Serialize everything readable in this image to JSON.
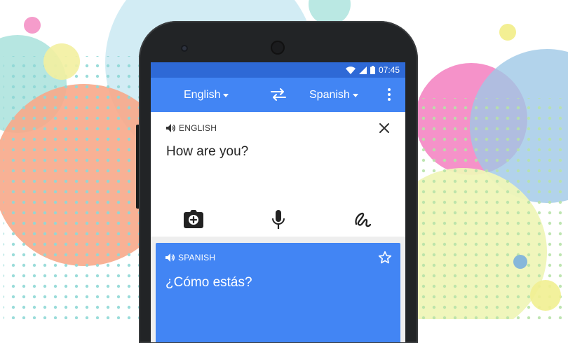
{
  "status_bar": {
    "time": "07:45"
  },
  "toolbar": {
    "source_language": "English",
    "target_language": "Spanish"
  },
  "input_card": {
    "language_label": "ENGLISH",
    "text": "How are you?"
  },
  "output_card": {
    "language_label": "SPANISH",
    "text": "¿Cómo estás?"
  },
  "colors": {
    "primary": "#4285f4",
    "status_bar": "#2e69d6",
    "phone_body": "#222426"
  },
  "icons": [
    "wifi-icon",
    "signal-icon",
    "battery-icon",
    "swap-icon",
    "more-vert-icon",
    "volume-icon",
    "close-icon",
    "camera-icon",
    "mic-icon",
    "handwriting-icon",
    "star-icon"
  ]
}
